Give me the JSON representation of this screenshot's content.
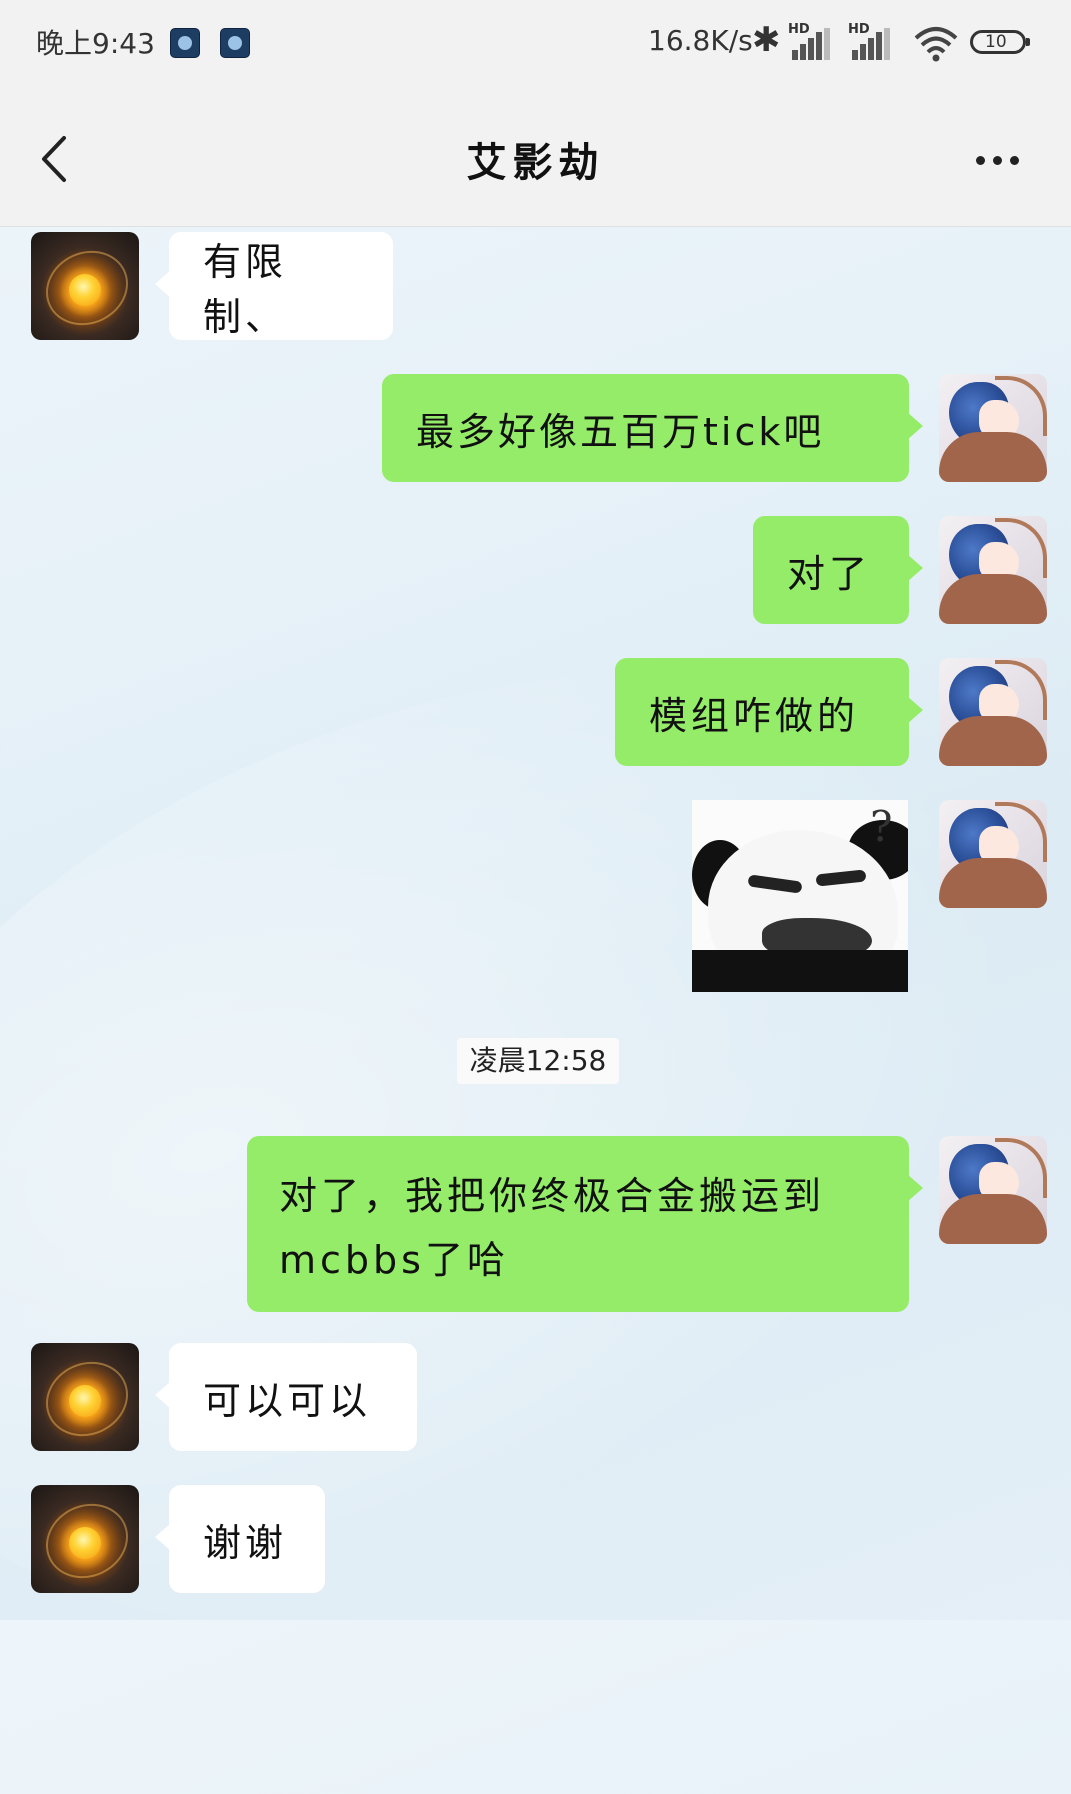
{
  "status_bar": {
    "time": "晚上9:43",
    "net_speed": "16.8K/s",
    "battery": "10",
    "signal_badge_1": "HD",
    "signal_badge_2": "HD"
  },
  "header": {
    "title": "艾影劫"
  },
  "messages": [
    {
      "side": "peer",
      "text": "有限制、"
    },
    {
      "side": "self",
      "text": "最多好像五百万tick吧"
    },
    {
      "side": "self",
      "text": "对了"
    },
    {
      "side": "self",
      "text": "模组咋做的"
    },
    {
      "side": "self",
      "type": "sticker"
    },
    {
      "side": "self",
      "text": "对了，我把你终极合金搬运到mcbbs了哈"
    },
    {
      "side": "peer",
      "text": "可以可以"
    },
    {
      "side": "peer",
      "text": "谢谢"
    }
  ],
  "time_separator": "凌晨12:58",
  "sticker": {
    "mark": "?"
  },
  "colors": {
    "self_bubble": "#95ec69",
    "peer_bubble": "#ffffff",
    "nav_bg": "#f2f2f2"
  },
  "icons": {
    "back": "back-arrow-icon",
    "more": "more-dots-icon",
    "bluetooth": "bluetooth-icon",
    "wifi": "wifi-icon"
  }
}
